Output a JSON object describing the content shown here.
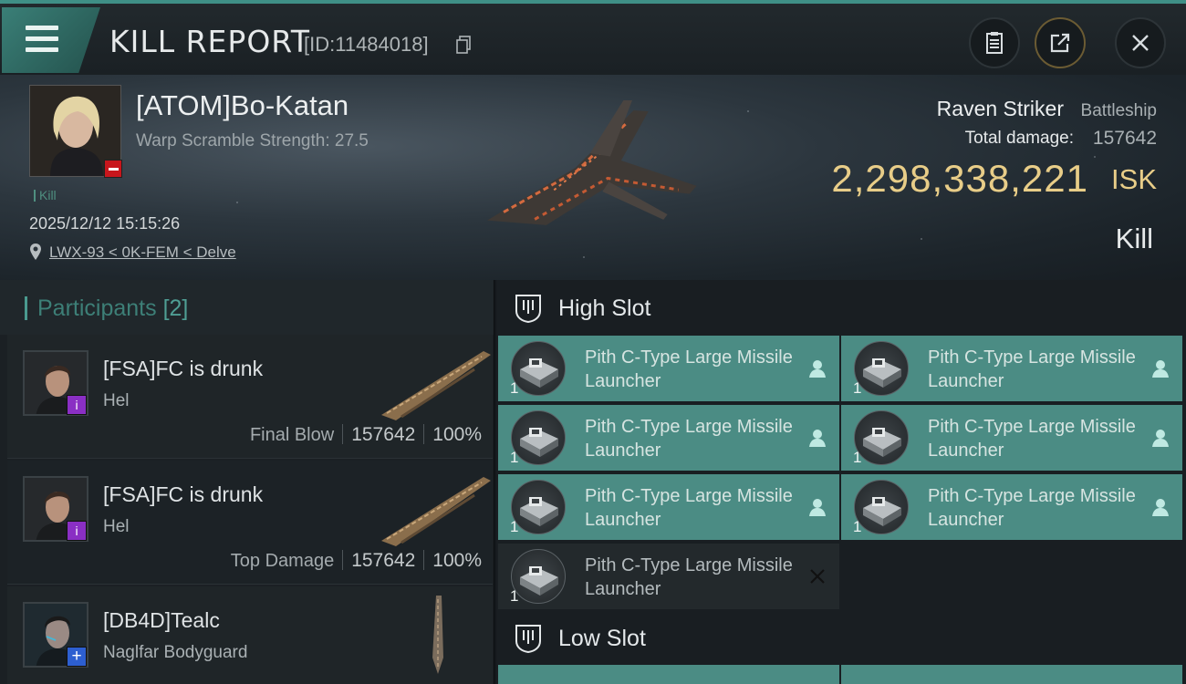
{
  "header": {
    "title": "KILL REPORT",
    "report_id": "[ID:11484018]"
  },
  "victim": {
    "name": "[ATOM]Bo-Katan",
    "warp_scramble": "Warp Scramble Strength: 27.5",
    "tag": "Kill",
    "datetime": "2025/12/12 15:15:26",
    "location": "LWX-93 < 0K-FEM < Delve",
    "ship_name": "Raven Striker",
    "ship_class": "Battleship",
    "total_damage_label": "Total damage:",
    "total_damage": "157642",
    "isk_value": "2,298,338,221",
    "isk_unit": "ISK",
    "result": "Kill"
  },
  "participants": {
    "title": "Participants",
    "count": "[2]",
    "rows": [
      {
        "name": "[FSA]FC is drunk",
        "ship": "Hel",
        "role": "Final Blow",
        "damage": "157642",
        "percent": "100%",
        "badge": "i"
      },
      {
        "name": "[FSA]FC is drunk",
        "ship": "Hel",
        "role": "Top Damage",
        "damage": "157642",
        "percent": "100%",
        "badge": "i"
      },
      {
        "name": "[DB4D]Tealc",
        "ship": "Naglfar Bodyguard",
        "badge": "+"
      }
    ]
  },
  "fitting": {
    "high_slot_title": "High Slot",
    "low_slot_title": "Low Slot",
    "high_slot": [
      {
        "name": "Pith C-Type Large Missile Launcher",
        "qty": "1",
        "status": "fitted"
      },
      {
        "name": "Pith C-Type Large Missile Launcher",
        "qty": "1",
        "status": "fitted"
      },
      {
        "name": "Pith C-Type Large Missile Launcher",
        "qty": "1",
        "status": "fitted"
      },
      {
        "name": "Pith C-Type Large Missile Launcher",
        "qty": "1",
        "status": "fitted"
      },
      {
        "name": "Pith C-Type Large Missile Launcher",
        "qty": "1",
        "status": "fitted"
      },
      {
        "name": "Pith C-Type Large Missile Launcher",
        "qty": "1",
        "status": "fitted"
      },
      {
        "name": "Pith C-Type Large Missile Launcher",
        "qty": "1",
        "status": "destroyed"
      }
    ]
  },
  "colors": {
    "accent": "#4b8c84",
    "isk": "#e8cd88",
    "destroyed_slot": "#23292c"
  }
}
